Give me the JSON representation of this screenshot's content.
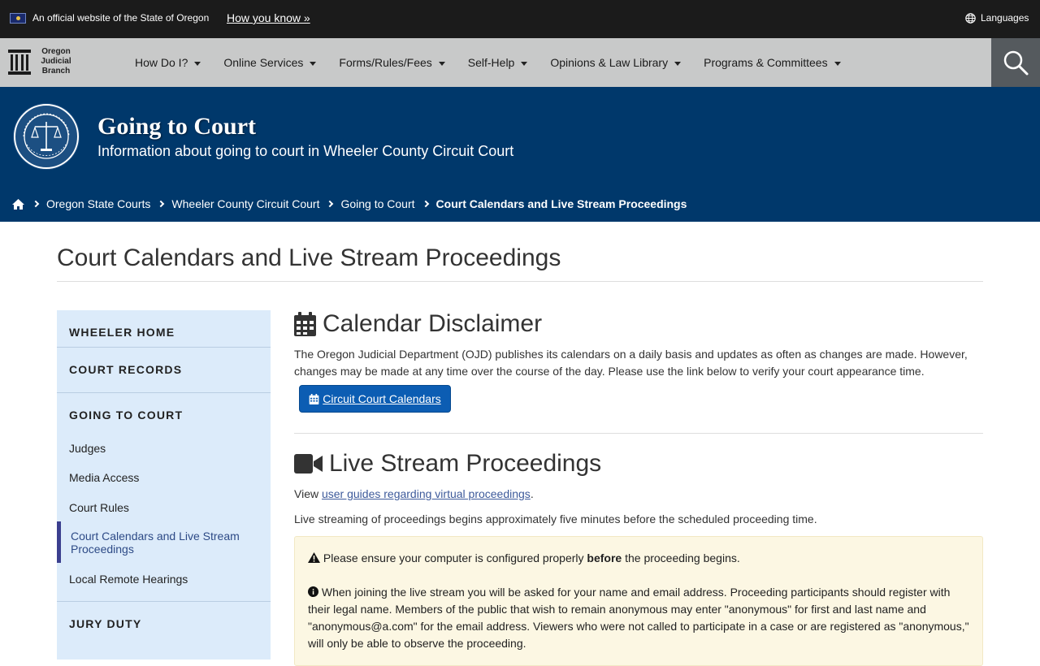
{
  "topbar": {
    "official_text": "An official website of the State of Oregon",
    "how_you_know": "How you know »",
    "languages": "Languages"
  },
  "nav": {
    "logo_lines": [
      "Oregon",
      "Judicial",
      "Branch"
    ],
    "items": [
      "How Do I?",
      "Online Services",
      "Forms/Rules/Fees",
      "Self-Help",
      "Opinions & Law Library",
      "Programs & Committees"
    ]
  },
  "hero": {
    "title": "Going to Court",
    "subtitle": "Information about going to court in Wheeler County Circuit Court"
  },
  "breadcrumb": {
    "items": [
      "Oregon State Courts",
      "Wheeler County Circuit Court",
      "Going to Court"
    ],
    "current": "Court Calendars and Live Stream Proceedings"
  },
  "page": {
    "title": "Court Calendars and Live Stream Proceedings"
  },
  "sidebar": {
    "wheeler_home": "WHEELER HOME",
    "court_records": "COURT RECORDS",
    "going_to_court": "GOING TO COURT",
    "links": [
      "Judges",
      "Media Access",
      "Court Rules"
    ],
    "active": "Court Calendars and Live Stream Proceedings",
    "local_remote": "Local Remote Hearings",
    "jury_duty": "JURY DUTY"
  },
  "calendar": {
    "heading": "Calendar Disclaimer",
    "body": "The Oregon Judicial Department (OJD) publishes its calendars on a daily basis and updates as often as changes are made. However, changes may be made at any time over the course of the day. Please use the link below to verify your court appearance time.",
    "button": "Circuit Court Calendars"
  },
  "livestream": {
    "heading": "Live Stream Proceedings",
    "view_prefix": "View ",
    "guides_link": "user guides regarding virtual proceedings",
    "view_suffix": ".",
    "body": "Live streaming of proceedings begins approximately five minutes before the scheduled proceeding time.",
    "alert_prefix": "Please ensure your computer is configured properly ",
    "alert_bold": "before",
    "alert_suffix": " the proceeding begins.",
    "info": "When joining the live stream you will be asked for your name and email address. Proceeding participants should register with their legal name. Members of the public that wish to remain anonymous may enter \"anonymous\" for first and last name and \"anonymous@a.com\" for the email address. Viewers who were not called to participate in a case or are registered as \"anonymous,\" will only be able to observe the proceeding."
  },
  "colors": {
    "topbar": "#1b1b1b",
    "nav": "#c8c9c9",
    "hero": "#00386b",
    "sidebar": "#dcebfa",
    "button": "#0c5db3",
    "alert": "#fcf7e3"
  },
  "icons": [
    "oregon-flag-icon",
    "globe-icon",
    "ojb-logo-icon",
    "search-icon",
    "seal-icon",
    "home-icon",
    "calendar-icon",
    "video-camera-icon",
    "warning-icon",
    "info-icon"
  ]
}
